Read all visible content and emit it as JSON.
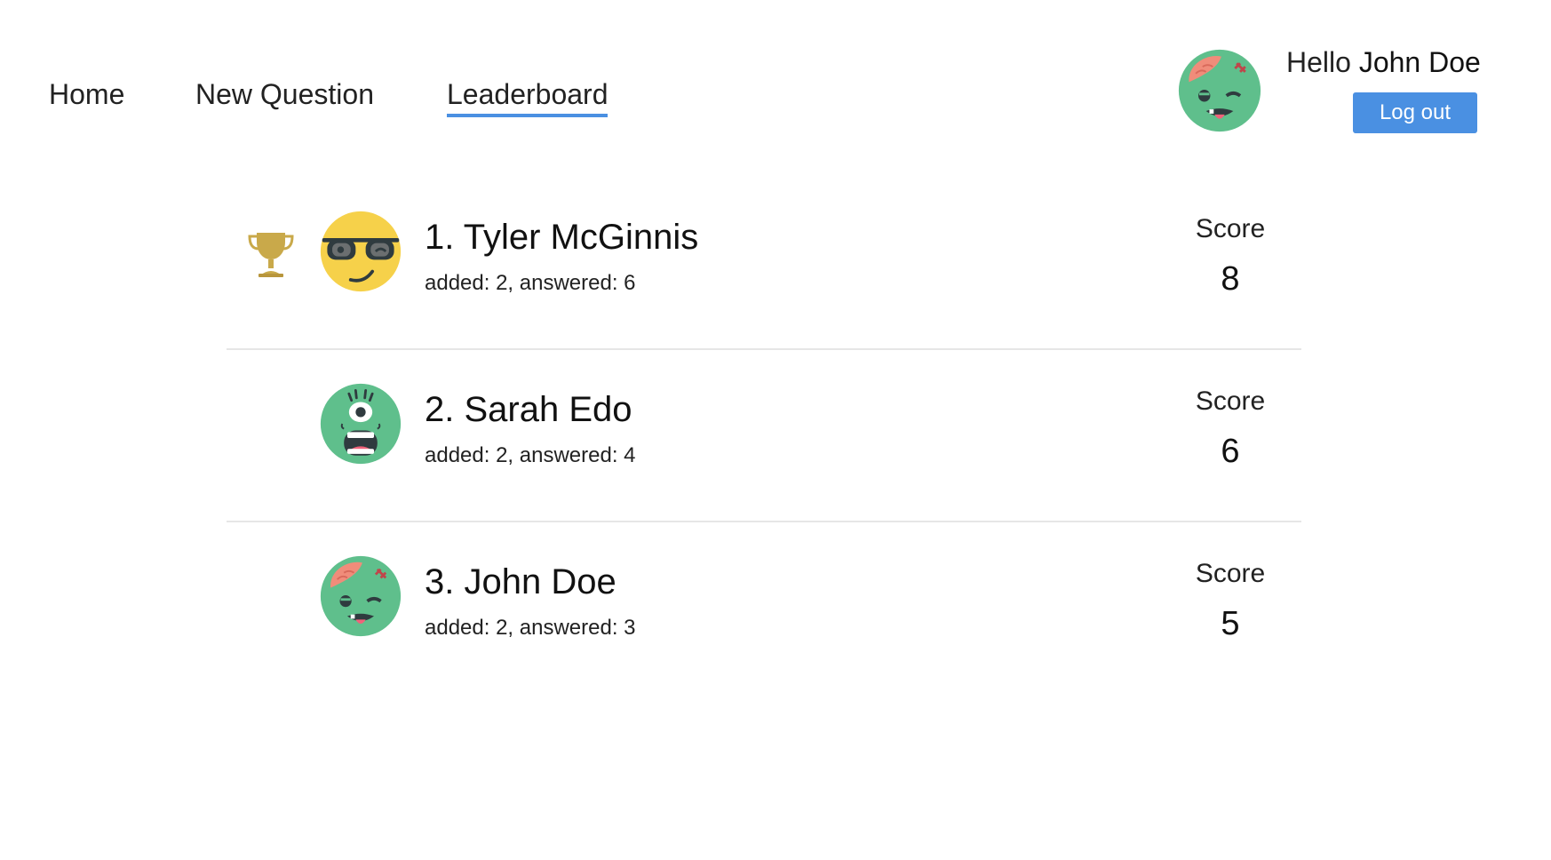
{
  "nav": {
    "home_label": "Home",
    "new_question_label": "New Question",
    "leaderboard_label": "Leaderboard",
    "active": "Leaderboard"
  },
  "user": {
    "greeting_prefix": "Hello",
    "name": "John Doe",
    "logout_label": "Log out",
    "avatar_icon": "zombie-icon"
  },
  "colors": {
    "accent": "#4a90e2",
    "trophy": "#c9a94a"
  },
  "leaderboard": {
    "score_label": "Score",
    "rows": [
      {
        "rank_name": "1. Tyler McGinnis",
        "stats": "added: 2, answered: 6",
        "score": "8",
        "avatar_icon": "cool-sunglasses-face-icon",
        "trophy": true
      },
      {
        "rank_name": "2. Sarah Edo",
        "stats": "added: 2, answered: 4",
        "score": "6",
        "avatar_icon": "cyclops-monster-icon",
        "trophy": false
      },
      {
        "rank_name": "3. John Doe",
        "stats": "added: 2, answered: 3",
        "score": "5",
        "avatar_icon": "zombie-icon",
        "trophy": false
      }
    ]
  }
}
